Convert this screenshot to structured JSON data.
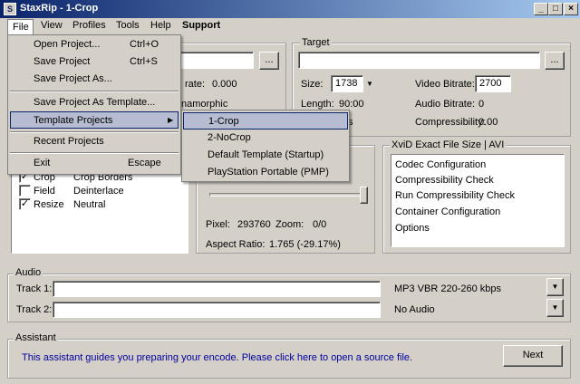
{
  "window": {
    "title": "StaxRip - 1-Crop",
    "icon": "staxrip-app-icon",
    "minimize": "_",
    "maximize": "□",
    "close": "×"
  },
  "menubar": {
    "file": "File",
    "view": "View",
    "profiles": "Profiles",
    "tools": "Tools",
    "help": "Help",
    "support": "Support"
  },
  "file_menu": {
    "open_project": "Open Project...",
    "open_shortcut": "Ctrl+O",
    "save_project": "Save Project",
    "save_shortcut": "Ctrl+S",
    "save_project_as": "Save Project As...",
    "save_as_template": "Save Project As Template...",
    "template_projects": "Template Projects",
    "recent_projects": "Recent Projects",
    "exit": "Exit",
    "exit_shortcut": "Escape"
  },
  "template_submenu": [
    "1-Crop",
    "2-NoCrop",
    "Default Template (Startup)",
    "PlayStation Portable (PMP)"
  ],
  "source": {
    "browse": "...",
    "frame_rate_label": "rate:",
    "frame_rate_value": "0.000",
    "anamorphic": "namorphic"
  },
  "target": {
    "title": "Target",
    "browse": "...",
    "size_label": "Size:",
    "size_value": "1738",
    "length_label": "Length:",
    "length_value": "90:00",
    "length_suffix": "s",
    "video_bitrate_label": "Video Bitrate:",
    "video_bitrate_value": "2700",
    "audio_bitrate_label": "Audio Bitrate:",
    "audio_bitrate_value": "0",
    "compressibility_label": "Compressibility:",
    "compressibility_value": "0.00"
  },
  "filters": [
    {
      "checked": true,
      "name": "Crop",
      "value": "Crop Borders"
    },
    {
      "checked": false,
      "name": "Field",
      "value": "Deinterlace"
    },
    {
      "checked": true,
      "name": "Resize",
      "value": "Neutral"
    }
  ],
  "resize": {
    "pixel_label": "Pixel:",
    "pixel_value": "293760",
    "zoom_label": "Zoom:",
    "zoom_value": "0/0",
    "aspect_label": "Aspect Ratio:",
    "aspect_value": "1.765 (-29.17%)",
    "slider_level": 1.0
  },
  "encoder": {
    "title": "XviD Exact File Size | AVI",
    "items": [
      "Codec Configuration",
      "Compressibility Check",
      "Run Compressibility Check",
      "Container Configuration",
      "Options"
    ]
  },
  "audio": {
    "title": "Audio",
    "track1_label": "Track 1:",
    "track1_value": "",
    "track1_profile": "MP3 VBR 220-260 kbps",
    "track2_label": "Track 2:",
    "track2_value": "",
    "track2_profile": "No Audio"
  },
  "assistant": {
    "title": "Assistant",
    "message": "This assistant guides you preparing your encode. Please click here to open a source file.",
    "next": "Next"
  },
  "colors": {
    "titlebar_start": "#0a246a",
    "titlebar_end": "#a6caf0",
    "menu_highlight": "#b6bdd2",
    "assistant_text": "#0000a0"
  }
}
